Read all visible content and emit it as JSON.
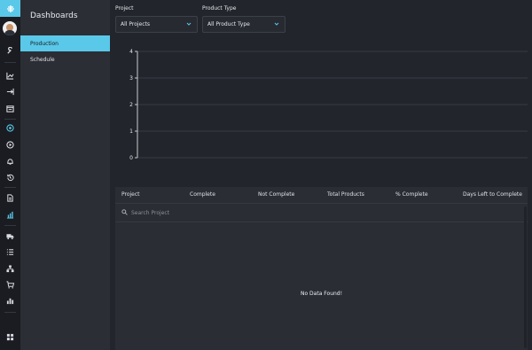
{
  "colors": {
    "accent": "#5ac8e8",
    "background": "#22252b",
    "sidebar": "#2b2e35",
    "rail": "#1a1c21"
  },
  "rail": {
    "icons": [
      "menu-icon",
      "avatar",
      "wrench-icon",
      "line-chart-icon",
      "logout-icon",
      "calendar-icon",
      "target-icon",
      "play-icon",
      "bell-icon",
      "history-icon",
      "document-icon",
      "bar-chart-icon",
      "truck-icon",
      "list-icon",
      "sitemap-icon",
      "cart-icon",
      "stats-icon",
      "grid-icon"
    ]
  },
  "nav": {
    "title": "Dashboards",
    "items": [
      {
        "label": "Production",
        "active": true
      },
      {
        "label": "Schedule",
        "active": false
      }
    ]
  },
  "filters": {
    "project": {
      "label": "Project",
      "value": "All Projects"
    },
    "product_type": {
      "label": "Product Type",
      "value": "All Product Type"
    }
  },
  "chart_data": {
    "type": "bar",
    "categories": [],
    "values": [],
    "ylim": [
      0,
      4
    ],
    "yticks": [
      "0",
      "1",
      "2",
      "3",
      "4"
    ],
    "grid": true
  },
  "table": {
    "columns": [
      "Project",
      "Complete",
      "Not Complete",
      "Total Products",
      "% Complete",
      "Days Left to Complete"
    ],
    "search_placeholder": "Search Project",
    "empty_message": "No Data Found!"
  }
}
